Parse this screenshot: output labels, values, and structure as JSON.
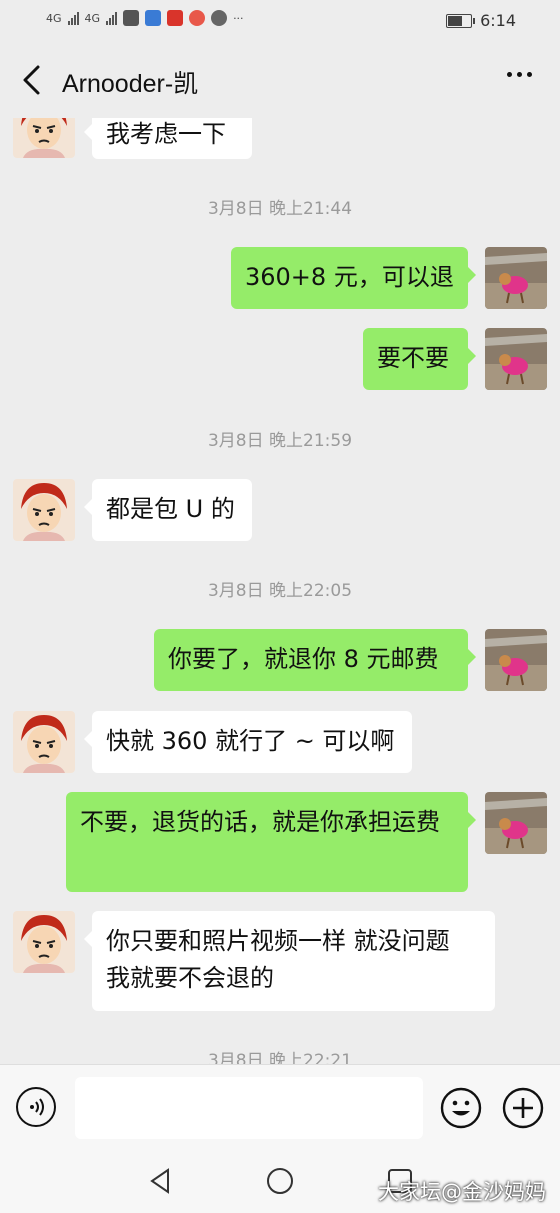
{
  "status_bar": {
    "network_1": "4G",
    "network_2": "4G",
    "time": "6:14",
    "more_glyph": "···"
  },
  "header": {
    "title": "Arnooder-凯",
    "back_icon": "chevron-left-icon",
    "more_icon": "more-dots-icon"
  },
  "messages": [
    {
      "side": "in",
      "text": "我考虑一下"
    },
    {
      "timestamp": "3月8日 晚上21:44"
    },
    {
      "side": "out",
      "text": "360+8 元，可以退"
    },
    {
      "side": "out",
      "text": "要不要"
    },
    {
      "timestamp": "3月8日 晚上21:59"
    },
    {
      "side": "in",
      "text": "都是包 U 的"
    },
    {
      "timestamp": "3月8日 晚上22:05"
    },
    {
      "side": "out",
      "text": "你要了，就退你 8 元邮费"
    },
    {
      "side": "in",
      "text": "快就 360 就行了 ~ 可以啊"
    },
    {
      "side": "out",
      "text": "不要，退货的话，就是你承担运费"
    },
    {
      "side": "in",
      "text": "你只要和照片视频一样 就没问题 我就要不会退的"
    },
    {
      "timestamp": "3月8日 晚上22:21"
    }
  ],
  "input_bar": {
    "placeholder": "",
    "voice_icon": "voice-icon",
    "emoji_icon": "emoji-icon",
    "plus_icon": "plus-icon"
  },
  "watermark": "大家坛@金沙妈妈",
  "colors": {
    "background": "#ededed",
    "bubble_out": "#95ec69",
    "bubble_in": "#ffffff",
    "timestamp": "#9a9a9a"
  }
}
